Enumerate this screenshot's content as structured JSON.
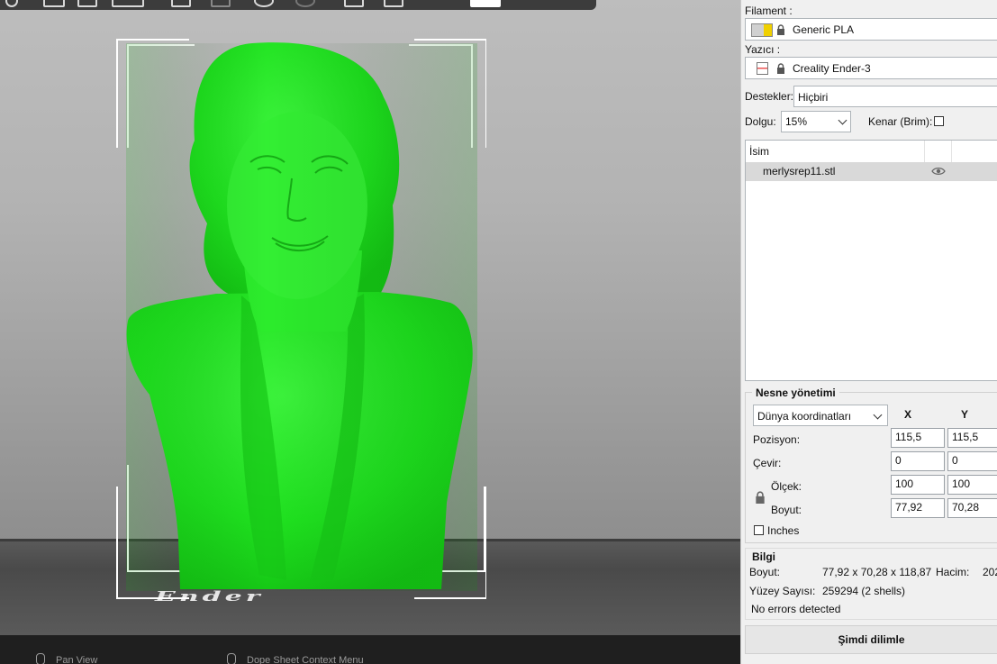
{
  "colors": {
    "model": "#1fe21f",
    "panel_bg": "#f0f0f0",
    "viewport_bg": "#a8a8a8"
  },
  "viewport": {
    "build_plate_text": "Ender",
    "status": [
      {
        "icon": "mouse-icon",
        "label": "Pan View"
      },
      {
        "icon": "mouse-icon",
        "label": "Dope Sheet Context Menu"
      }
    ]
  },
  "panel": {
    "filament_label": "Filament :",
    "filament_value": "Generic PLA",
    "printer_label": "Yazıcı :",
    "printer_value": "Creality Ender-3",
    "supports_label": "Destekler:",
    "supports_value": "Hiçbiri",
    "infill_label": "Dolgu:",
    "infill_value": "15%",
    "brim_label": "Kenar (Brim):",
    "object_list": {
      "column_name": "İsim",
      "rows": [
        {
          "name": "merlysrep11.stl",
          "icon": "eye-icon"
        }
      ]
    },
    "object_manip": {
      "title": "Nesne yönetimi",
      "coord_system": "Dünya koordinatları",
      "col_x": "X",
      "col_y": "Y",
      "position_label": "Pozisyon:",
      "position": [
        "115,5",
        "115,5"
      ],
      "rotation_label": "Çevir:",
      "rotation": [
        "0",
        "0"
      ],
      "scale_label": "Ölçek:",
      "scale": [
        "100",
        "100"
      ],
      "size_label": "Boyut:",
      "size": [
        "77,92",
        "70,28"
      ],
      "inches_label": "Inches"
    },
    "info": {
      "title": "Bilgi",
      "size_label": "Boyut:",
      "size_value": "77,92 x 70,28 x 118,87",
      "volume_label": "Hacim:",
      "volume_value": "202",
      "facets_label": "Yüzey Sayısı:",
      "facets_value": "259294 (2 shells)",
      "errors": "No errors detected"
    },
    "slice_button": "Şimdi dilimle"
  }
}
